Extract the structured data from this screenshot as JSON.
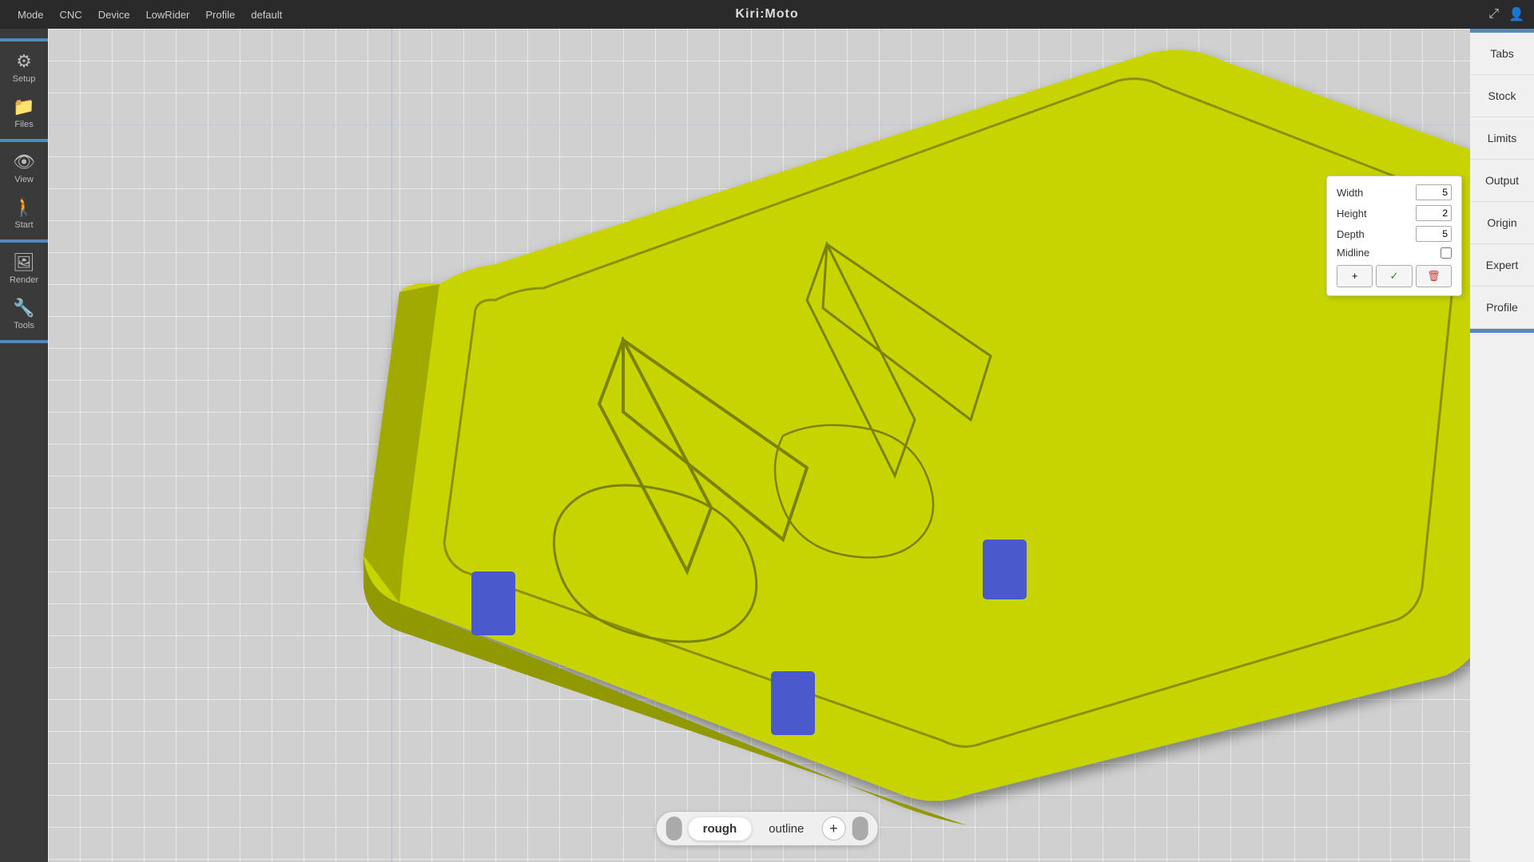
{
  "app": {
    "title": "Kiri:Moto"
  },
  "topbar": {
    "mode_label": "Mode",
    "cnc_label": "CNC",
    "device_label": "Device",
    "device_value": "LowRider",
    "profile_label": "Profile",
    "profile_value": "default",
    "expand_icon": "⤢",
    "user_icon": "👤"
  },
  "sidebar": {
    "items": [
      {
        "label": "Setup",
        "icon": "⚙"
      },
      {
        "label": "Files",
        "icon": "📁"
      },
      {
        "label": "View",
        "icon": "👁"
      },
      {
        "label": "Start",
        "icon": "🚶"
      },
      {
        "label": "Render",
        "icon": "🖼"
      },
      {
        "label": "Tools",
        "icon": "🔧"
      }
    ]
  },
  "right_panel": {
    "items": [
      {
        "label": "Tabs"
      },
      {
        "label": "Stock"
      },
      {
        "label": "Limits"
      },
      {
        "label": "Output"
      },
      {
        "label": "Origin"
      },
      {
        "label": "Expert"
      },
      {
        "label": "Profile"
      }
    ]
  },
  "tabs_popup": {
    "width_label": "Width",
    "width_value": "5",
    "height_label": "Height",
    "height_value": "2",
    "depth_label": "Depth",
    "depth_value": "5",
    "midline_label": "Midline",
    "add_btn": "+",
    "confirm_btn": "✓",
    "delete_btn": "🗑"
  },
  "bottom_toolbar": {
    "items": [
      {
        "label": "rough",
        "active": true
      },
      {
        "label": "outline",
        "active": false
      }
    ],
    "add_label": "+"
  },
  "colors": {
    "model_yellow": "#d4e000",
    "tab_blue": "#4a5acd",
    "sidebar_bg": "#3a3a3a",
    "accent_blue": "#5588bb"
  }
}
